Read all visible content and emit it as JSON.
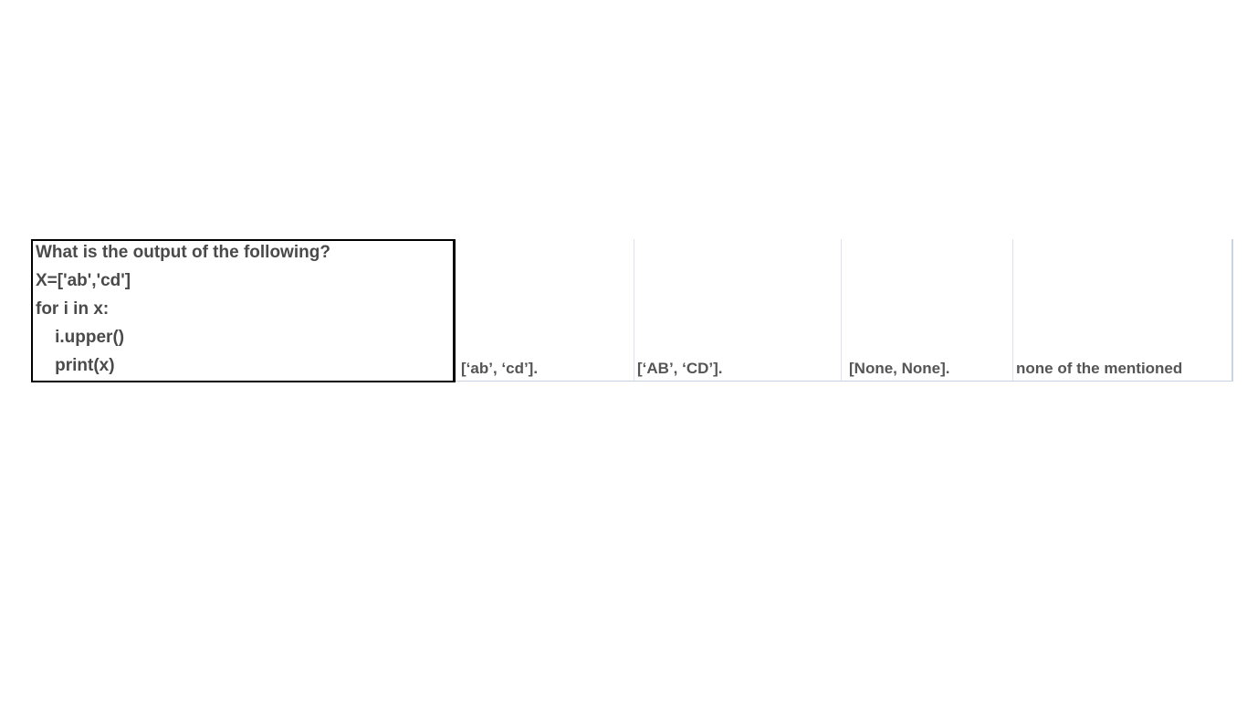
{
  "question": {
    "lines": [
      "What is the output of the following?",
      "X=['ab','cd']",
      "for i in x:",
      "    i.upper()",
      "    print(x)"
    ]
  },
  "options": [
    "[‘ab’, ‘cd’].",
    "[‘AB’, ‘CD’].",
    "[None, None].",
    "none of the mentioned"
  ]
}
